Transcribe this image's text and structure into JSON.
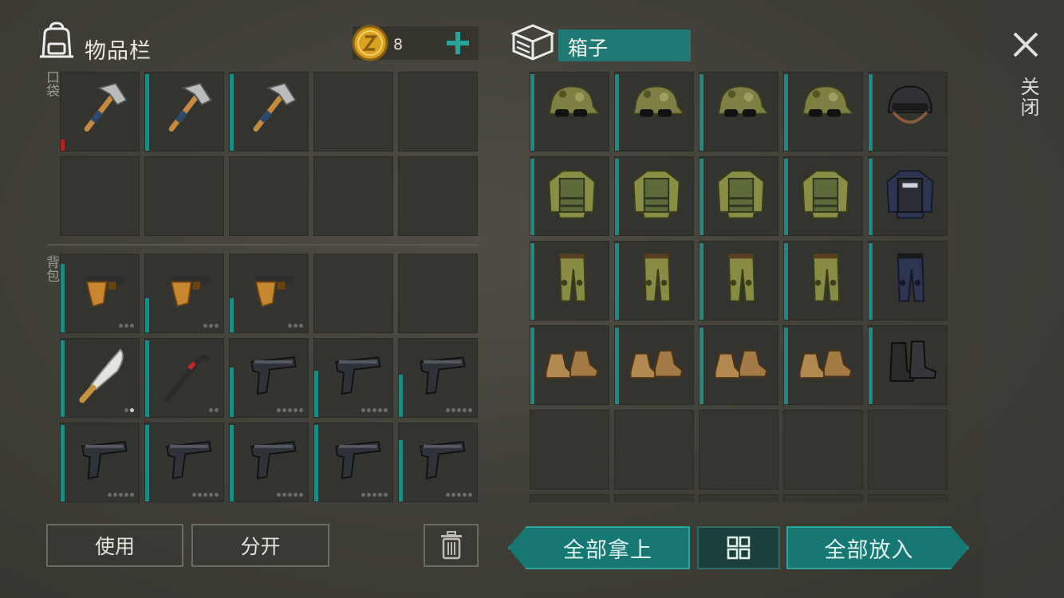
{
  "inventory": {
    "title": "物品栏",
    "coins": "8",
    "pocket_label": "口袋",
    "backpack_label": "背包"
  },
  "container": {
    "title": "箱子"
  },
  "close_label": "关闭",
  "buttons": {
    "use": "使用",
    "split": "分开",
    "take_all": "全部拿上",
    "put_all": "全部放入"
  },
  "colors": {
    "accent_teal": "#1f7a76",
    "durability_bar": "#1e8a85",
    "low_durability": "#b32121",
    "coin_gold": "#d9a320"
  },
  "pocket_slots": [
    {
      "item": "pickaxe-icon",
      "durability": 0.15,
      "low": true
    },
    {
      "item": "pickaxe-icon",
      "durability": 1.0
    },
    {
      "item": "pickaxe-icon",
      "durability": 1.0
    },
    {
      "item": null
    },
    {
      "item": null
    },
    {
      "item": null
    },
    {
      "item": null
    },
    {
      "item": null
    },
    {
      "item": null
    },
    {
      "item": null
    }
  ],
  "backpack_slots": [
    {
      "item": "flare-gun-icon",
      "durability": 0.9,
      "dots": 3,
      "filled": 0
    },
    {
      "item": "flare-gun-icon",
      "durability": 0.45,
      "dots": 3,
      "filled": 0
    },
    {
      "item": "flare-gun-icon",
      "durability": 0.45,
      "dots": 3,
      "filled": 0
    },
    {
      "item": null
    },
    {
      "item": null
    },
    {
      "item": "machete-icon",
      "durability": 1.0,
      "dots": 2,
      "filled": 1
    },
    {
      "item": "crowbar-icon",
      "durability": 1.0,
      "dots": 2,
      "filled": 0
    },
    {
      "item": "pistol-icon",
      "durability": 0.65,
      "dots": 5,
      "filled": 0
    },
    {
      "item": "pistol-icon",
      "durability": 0.6,
      "dots": 5,
      "filled": 0
    },
    {
      "item": "pistol-icon",
      "durability": 0.55,
      "dots": 5,
      "filled": 0
    },
    {
      "item": "pistol-icon",
      "durability": 1.0,
      "dots": 5,
      "filled": 0
    },
    {
      "item": "pistol-icon",
      "durability": 1.0,
      "dots": 5,
      "filled": 0
    },
    {
      "item": "pistol-icon",
      "durability": 1.0,
      "dots": 5,
      "filled": 0
    },
    {
      "item": "pistol-icon",
      "durability": 1.0,
      "dots": 5,
      "filled": 0
    },
    {
      "item": "pistol-icon",
      "durability": 0.8,
      "dots": 5,
      "filled": 0
    }
  ],
  "container_slots": [
    {
      "item": "camo-cap-icon",
      "durability": 1.0
    },
    {
      "item": "camo-cap-icon",
      "durability": 1.0
    },
    {
      "item": "camo-cap-icon",
      "durability": 1.0
    },
    {
      "item": "camo-cap-icon",
      "durability": 1.0
    },
    {
      "item": "police-helmet-icon",
      "durability": 1.0
    },
    {
      "item": "camo-jacket-icon",
      "durability": 1.0
    },
    {
      "item": "camo-jacket-icon",
      "durability": 1.0
    },
    {
      "item": "camo-jacket-icon",
      "durability": 1.0
    },
    {
      "item": "camo-jacket-icon",
      "durability": 1.0
    },
    {
      "item": "police-jacket-icon",
      "durability": 1.0
    },
    {
      "item": "camo-pants-icon",
      "durability": 1.0
    },
    {
      "item": "camo-pants-icon",
      "durability": 1.0
    },
    {
      "item": "camo-pants-icon",
      "durability": 1.0
    },
    {
      "item": "camo-pants-icon",
      "durability": 1.0
    },
    {
      "item": "police-pants-icon",
      "durability": 1.0
    },
    {
      "item": "tan-boots-icon",
      "durability": 1.0
    },
    {
      "item": "tan-boots-icon",
      "durability": 1.0
    },
    {
      "item": "tan-boots-icon",
      "durability": 1.0
    },
    {
      "item": "tan-boots-icon",
      "durability": 1.0
    },
    {
      "item": "black-boots-icon",
      "durability": 1.0
    },
    {
      "item": null
    },
    {
      "item": null
    },
    {
      "item": null
    },
    {
      "item": null
    },
    {
      "item": null
    },
    {
      "item": null
    },
    {
      "item": null
    },
    {
      "item": null
    },
    {
      "item": null
    },
    {
      "item": null
    }
  ]
}
